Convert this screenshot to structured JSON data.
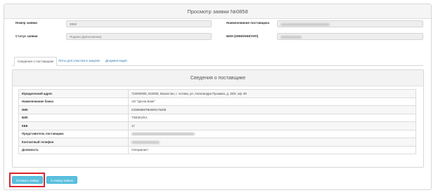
{
  "window": {
    "title": "Просмотр заявки №0858"
  },
  "fields": {
    "number_label": "Номер заявки",
    "number_value": "0858",
    "status_label": "Статус заявки",
    "status_value": "Подана (Дополнение)",
    "supplier_name_label": "Наименование поставщика",
    "bin_label": "БИН (ИИН/ИНН/УНП)"
  },
  "tabs": [
    {
      "label": "Сведения о поставщике",
      "active": true
    },
    {
      "label": "Лоты для участия в закупке",
      "active": false
    },
    {
      "label": "Документация",
      "active": false
    }
  ],
  "supplier_section": {
    "title": "Сведения о поставщике",
    "rows": [
      {
        "key": "Юридический адрес",
        "value": "710000000, 010000, Казахстан, г. Астана, ул. Александра Пушкина, д. 25/3, оф. 90"
      },
      {
        "key": "Наименование банка",
        "value": "АО \"Цесна Банк\""
      },
      {
        "key": "ИИК",
        "value": "KZ596998TB0000175305"
      },
      {
        "key": "БИК",
        "value": "TSESKZKA"
      },
      {
        "key": "КБЕ",
        "value": "17"
      },
      {
        "key": "Представитель поставщика",
        "value": ""
      },
      {
        "key": "Контактный телефон",
        "value": ""
      },
      {
        "key": "Должность",
        "value": "Специалист"
      }
    ]
  },
  "buttons": {
    "withdraw": "Отозвать заявку",
    "to_list": "К списку заявок"
  },
  "colors": {
    "button_info": "#5bc0de",
    "highlight": "#d9262c",
    "link": "#2a78b6"
  }
}
